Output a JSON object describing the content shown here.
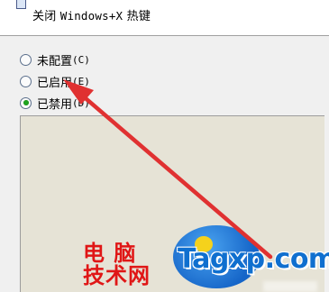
{
  "header": {
    "title_prefix": "关闭",
    "title_hotkey": "Windows+X",
    "title_suffix": "热键",
    "icon": "policy-setting-icon"
  },
  "options": [
    {
      "label": "未配置",
      "accelerator": "(C)",
      "selected": false
    },
    {
      "label": "已启用",
      "accelerator": "(E)",
      "selected": false
    },
    {
      "label": "已禁用",
      "accelerator": "(D)",
      "selected": true
    }
  ],
  "watermark": {
    "line1": "电 脑",
    "line2": "技术网",
    "site": "Tagxp.com"
  },
  "colors": {
    "arrow": "#e03131",
    "radio_selected": "#1fa51f",
    "watermark_red": "#e01616",
    "watermark_blue": "#0f6fcf",
    "panel_background": "#e6e3d6"
  }
}
